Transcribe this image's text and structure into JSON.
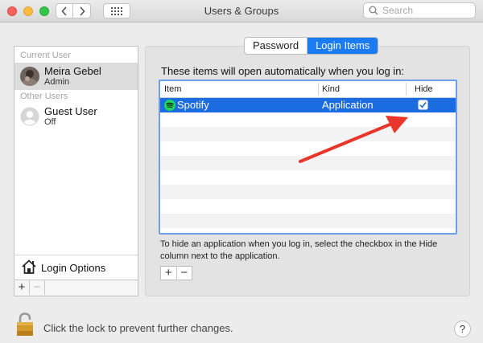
{
  "window": {
    "title": "Users & Groups"
  },
  "search": {
    "placeholder": "Search"
  },
  "sidebar": {
    "current_user_label": "Current User",
    "other_users_label": "Other Users",
    "users": [
      {
        "name": "Meira Gebel",
        "role": "Admin",
        "selected": true
      },
      {
        "name": "Guest User",
        "role": "Off",
        "selected": false
      }
    ],
    "login_options_label": "Login Options",
    "add_label": "+",
    "remove_label": "−"
  },
  "tabs": [
    {
      "label": "Password",
      "active": false
    },
    {
      "label": "Login Items",
      "active": true
    }
  ],
  "login_items": {
    "intro": "These items will open automatically when you log in:",
    "columns": [
      "Item",
      "Kind",
      "Hide"
    ],
    "rows": [
      {
        "item": "Spotify",
        "kind": "Application",
        "hide": true,
        "selected": true
      }
    ],
    "help_text": "To hide an application when you log in, select the checkbox in the Hide column next to the application.",
    "add_label": "+",
    "remove_label": "−"
  },
  "footer": {
    "lock_text": "Click the lock to prevent further changes.",
    "help_label": "?"
  },
  "colors": {
    "selection": "#1c6ce1",
    "tab_active": "#1b7bf3",
    "arrow": "#e8362c",
    "spotify": "#1ed760"
  }
}
